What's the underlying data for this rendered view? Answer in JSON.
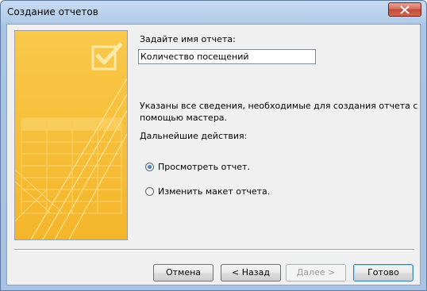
{
  "window": {
    "title": "Создание отчетов"
  },
  "form": {
    "name_label": "Задайте имя отчета:",
    "name_value": "Количество посещений",
    "info_text_line1": "Указаны все сведения, необходимые для создания отчета с",
    "info_text_line2": "помощью мастера.",
    "next_actions_label": "Дальнейшие действия:",
    "options": [
      {
        "label": "Просмотреть отчет.",
        "checked": true
      },
      {
        "label": "Изменить макет отчета.",
        "checked": false
      }
    ]
  },
  "buttons": {
    "cancel": "Отмена",
    "back": "< Назад",
    "next": "Далее >",
    "finish": "Готово"
  },
  "colors": {
    "banner": "#f7c23b",
    "title_bar": "#b4cde9",
    "close_button": "#c24a36"
  }
}
